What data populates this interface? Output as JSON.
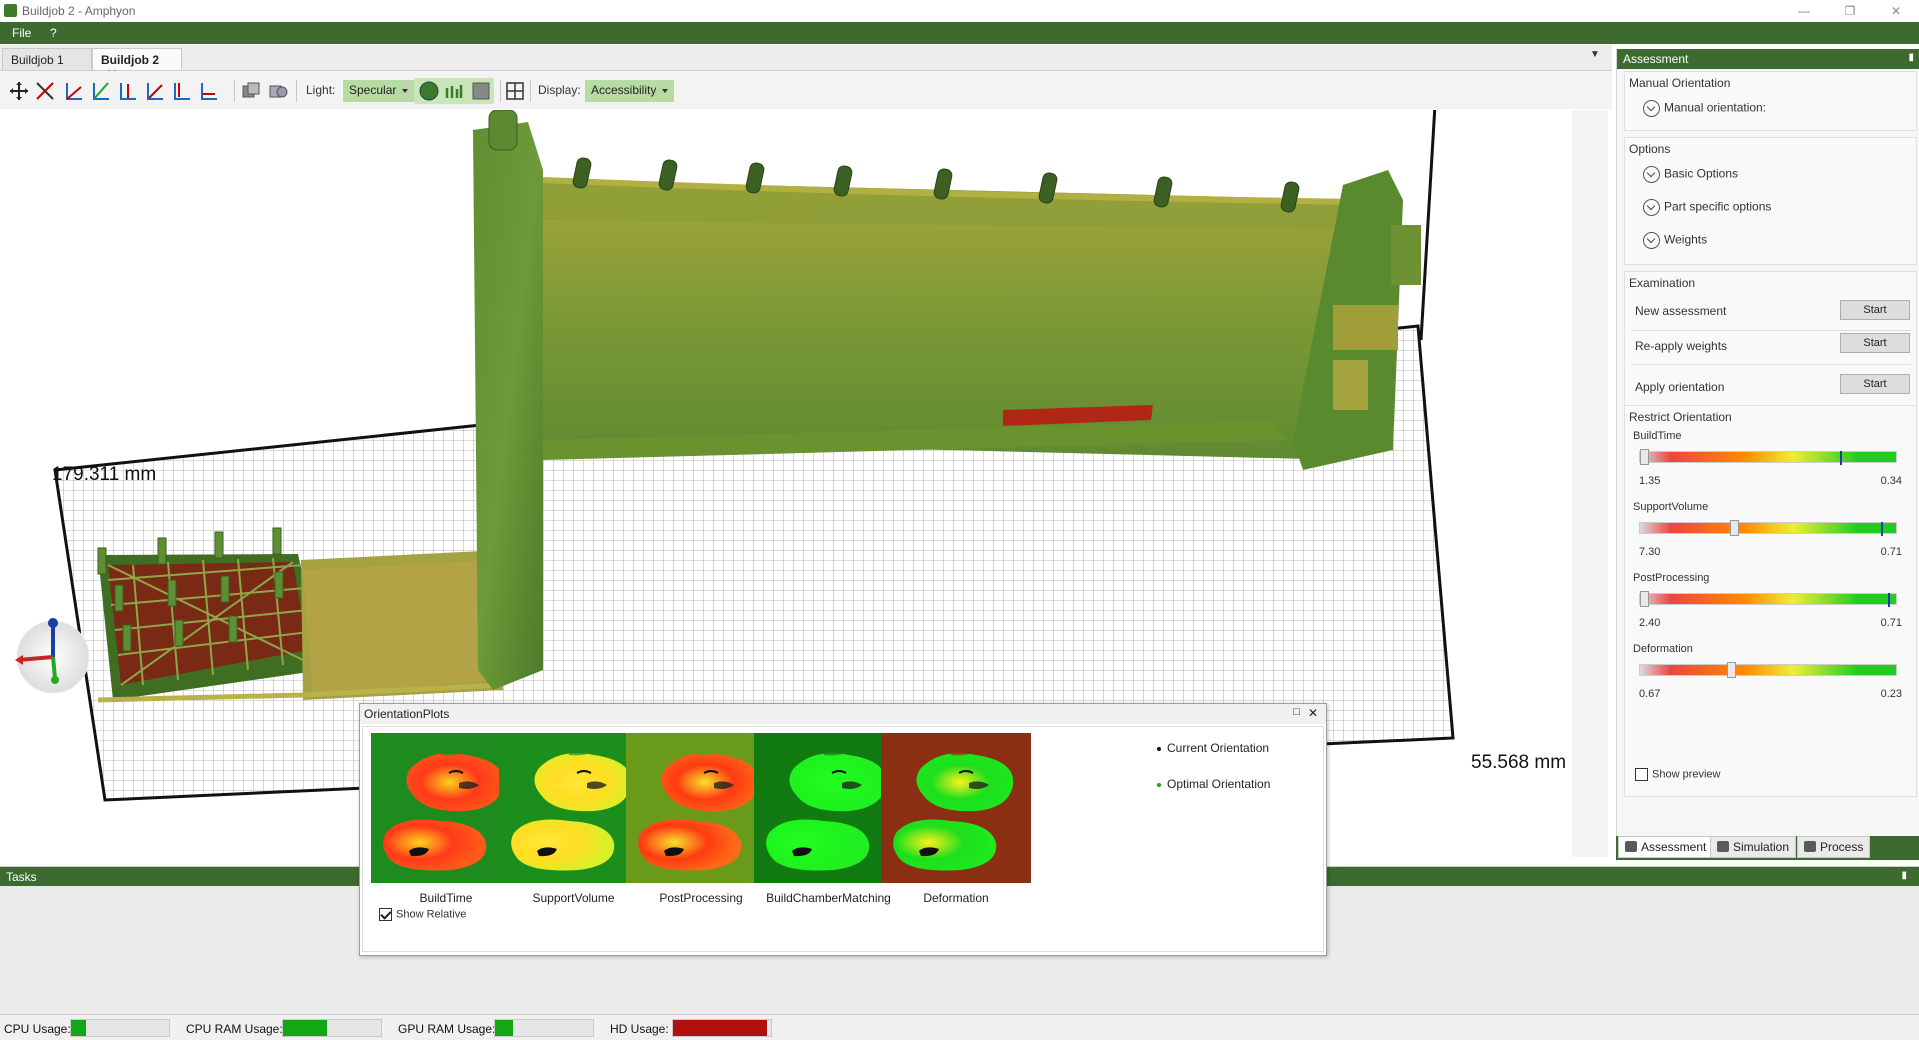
{
  "window": {
    "title": "Buildjob 2 - Amphyon",
    "minimize": "—",
    "maximize": "❐",
    "close": "✕"
  },
  "menu": [
    "File",
    "?"
  ],
  "doc_tabs": [
    {
      "label": "Buildjob 1",
      "active": false
    },
    {
      "label": "Buildjob 2",
      "active": true,
      "close": "✕"
    }
  ],
  "toolbar": {
    "light_label": "Light:",
    "light_value": "Specular",
    "display_label": "Display:",
    "display_value": "Accessibility"
  },
  "viewport": {
    "dim_left": "179.311 mm",
    "dim_right": "55.568 mm"
  },
  "assessment": {
    "header": "Assessment",
    "pin": "📌",
    "manual_orientation": {
      "title": "Manual Orientation",
      "item": "Manual orientation:"
    },
    "options": {
      "title": "Options",
      "items": [
        "Basic Options",
        "Part specific options",
        "Weights"
      ]
    },
    "examination": {
      "title": "Examination",
      "rows": [
        {
          "label": "New assessment",
          "button": "Start"
        },
        {
          "label": "Re-apply weights",
          "button": "Start"
        },
        {
          "label": "Apply orientation",
          "button": "Start"
        }
      ]
    },
    "restrict": {
      "title": "Restrict Orientation",
      "sliders": [
        {
          "name": "BuildTime",
          "min": "1.35",
          "max": "0.34",
          "thumb": 0.0,
          "marker": 0.78
        },
        {
          "name": "SupportVolume",
          "min": "7.30",
          "max": "0.71",
          "thumb": 0.36,
          "marker": 0.94
        },
        {
          "name": "PostProcessing",
          "min": "2.40",
          "max": "0.71",
          "thumb": 0.0,
          "marker": 0.97
        },
        {
          "name": "Deformation",
          "min": "0.67",
          "max": "0.23",
          "thumb": 0.35,
          "marker": null
        }
      ],
      "show_preview": "Show preview"
    }
  },
  "bottom_tabs": [
    {
      "label": "Assessment",
      "active": true
    },
    {
      "label": "Simulation",
      "active": false
    },
    {
      "label": "Process",
      "active": false
    }
  ],
  "tasks": {
    "header": "Tasks"
  },
  "status": [
    {
      "label": "CPU Usage:",
      "fill": 0.15,
      "color": "#13a813"
    },
    {
      "label": "CPU RAM Usage:",
      "fill": 0.45,
      "color": "#13a813"
    },
    {
      "label": "GPU RAM Usage:",
      "fill": 0.18,
      "color": "#13a813"
    },
    {
      "label": "HD Usage:",
      "fill": 0.96,
      "color": "#b30f0f"
    }
  ],
  "orientation_plots": {
    "title": "OrientationPlots",
    "plots": [
      "BuildTime",
      "SupportVolume",
      "PostProcessing",
      "BuildChamberMatching",
      "Deformation"
    ],
    "legend": [
      {
        "label": "Current Orientation",
        "color": "#111111"
      },
      {
        "label": "Optimal Orientation",
        "color": "#17a517"
      }
    ],
    "show_relative": "Show Relative"
  }
}
